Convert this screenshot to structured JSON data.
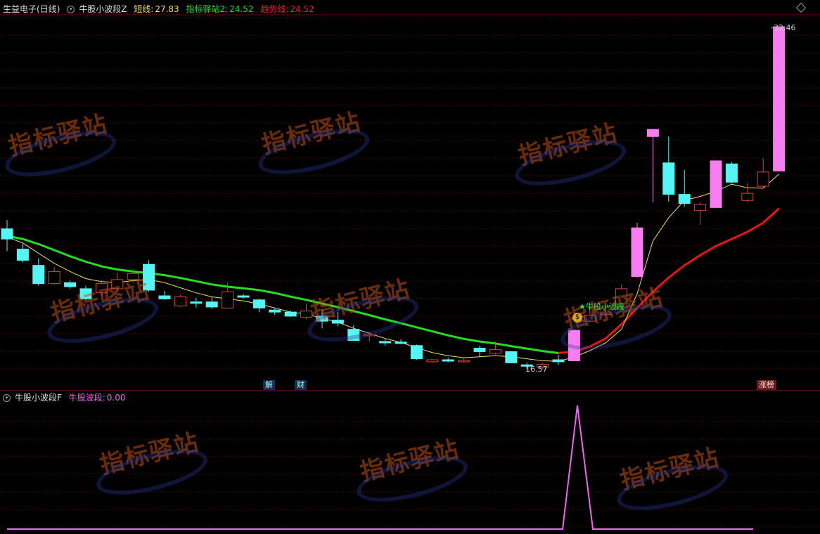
{
  "header_main": {
    "stock": "生益电子",
    "period": "(日线)",
    "indicator": "牛股小波段Z",
    "short_label": "短线:",
    "short_value": "27.83",
    "station_label": "指标驿站2:",
    "station_value": "24.52",
    "trend_label": "趋势线:",
    "trend_value": "24.52"
  },
  "header_sub": {
    "indicator": "牛股小波段F",
    "series_label": "牛股波段:",
    "series_value": "0.00"
  },
  "annotations": {
    "high_label": "32.46",
    "low_label": "16.57",
    "signal_label": "★牛股小波段",
    "event_jie": "解",
    "event_cai": "财",
    "event_zhangbang": "涨榜"
  },
  "watermark_text": "指标驿站",
  "colors": {
    "up": "#e0453a",
    "down": "#56f5f5",
    "limit_up": "#f77df0",
    "short_line": "#f0e060",
    "station_line": "#22dd22",
    "trend_line": "#ee1111",
    "sub_line": "#f065f0",
    "grid": "#5a1010",
    "background": "#000000"
  },
  "chart_data": [
    {
      "type": "candlestick",
      "title": "生益电子 (日线)",
      "y_range": [
        16.0,
        33.0
      ],
      "candles": [
        {
          "o": 22.5,
          "c": 22.0,
          "h": 22.93,
          "l": 21.4,
          "s": "down"
        },
        {
          "o": 21.5,
          "c": 20.95,
          "h": 21.75,
          "l": 20.85,
          "s": "down"
        },
        {
          "o": 20.7,
          "c": 19.8,
          "h": 21.05,
          "l": 19.7,
          "s": "down"
        },
        {
          "o": 19.8,
          "c": 20.4,
          "h": 20.62,
          "l": 19.75,
          "s": "up"
        },
        {
          "o": 19.85,
          "c": 19.65,
          "h": 19.95,
          "l": 19.55,
          "s": "down"
        },
        {
          "o": 19.55,
          "c": 19.05,
          "h": 19.7,
          "l": 18.98,
          "s": "down"
        },
        {
          "o": 19.35,
          "c": 19.8,
          "h": 19.98,
          "l": 19.2,
          "s": "up"
        },
        {
          "o": 19.55,
          "c": 20.0,
          "h": 20.35,
          "l": 19.4,
          "s": "up"
        },
        {
          "o": 20.0,
          "c": 20.3,
          "h": 20.5,
          "l": 19.85,
          "s": "up"
        },
        {
          "o": 20.75,
          "c": 19.48,
          "h": 20.95,
          "l": 19.4,
          "s": "down"
        },
        {
          "o": 19.2,
          "c": 19.05,
          "h": 19.45,
          "l": 19.0,
          "s": "down"
        },
        {
          "o": 18.7,
          "c": 19.15,
          "h": 19.25,
          "l": 18.65,
          "s": "up"
        },
        {
          "o": 18.9,
          "c": 18.85,
          "h": 19.1,
          "l": 18.62,
          "s": "down"
        },
        {
          "o": 18.9,
          "c": 18.65,
          "h": 19.12,
          "l": 18.55,
          "s": "down"
        },
        {
          "o": 18.6,
          "c": 19.4,
          "h": 19.85,
          "l": 18.6,
          "s": "up"
        },
        {
          "o": 19.2,
          "c": 19.15,
          "h": 19.3,
          "l": 19.05,
          "s": "down"
        },
        {
          "o": 19.0,
          "c": 18.6,
          "h": 19.05,
          "l": 18.4,
          "s": "down"
        },
        {
          "o": 18.5,
          "c": 18.4,
          "h": 18.62,
          "l": 18.25,
          "s": "down"
        },
        {
          "o": 18.4,
          "c": 18.2,
          "h": 18.48,
          "l": 18.15,
          "s": "down"
        },
        {
          "o": 18.15,
          "c": 18.45,
          "h": 18.82,
          "l": 18.05,
          "s": "up"
        },
        {
          "o": 18.2,
          "c": 17.95,
          "h": 18.55,
          "l": 17.6,
          "s": "down"
        },
        {
          "o": 18.0,
          "c": 17.85,
          "h": 18.4,
          "l": 17.7,
          "s": "down"
        },
        {
          "o": 17.55,
          "c": 17.0,
          "h": 17.75,
          "l": 16.98,
          "s": "down"
        },
        {
          "o": 17.28,
          "c": 17.3,
          "h": 17.45,
          "l": 16.95,
          "s": "up"
        },
        {
          "o": 16.95,
          "c": 16.9,
          "h": 17.1,
          "l": 16.75,
          "s": "down"
        },
        {
          "o": 16.92,
          "c": 16.9,
          "h": 17.05,
          "l": 16.82,
          "s": "down"
        },
        {
          "o": 16.75,
          "c": 16.1,
          "h": 16.8,
          "l": 16.05,
          "s": "down"
        },
        {
          "o": 15.95,
          "c": 16.05,
          "h": 16.1,
          "l": 15.9,
          "s": "up"
        },
        {
          "o": 16.05,
          "c": 16.0,
          "h": 16.15,
          "l": 15.92,
          "s": "down"
        },
        {
          "o": 15.98,
          "c": 16.02,
          "h": 16.12,
          "l": 15.9,
          "s": "up"
        },
        {
          "o": 16.62,
          "c": 16.45,
          "h": 16.75,
          "l": 16.2,
          "s": "down"
        },
        {
          "o": 16.37,
          "c": 16.55,
          "h": 16.95,
          "l": 16.3,
          "s": "up"
        },
        {
          "o": 16.45,
          "c": 15.9,
          "h": 16.48,
          "l": 15.88,
          "s": "down"
        },
        {
          "o": 15.8,
          "c": 15.75,
          "h": 15.9,
          "l": 15.7,
          "s": "down"
        },
        {
          "o": 15.68,
          "c": 15.82,
          "h": 15.9,
          "l": 15.6,
          "s": "up"
        },
        {
          "o": 16.05,
          "c": 15.95,
          "h": 16.3,
          "l": 15.8,
          "s": "down"
        },
        {
          "o": 16.0,
          "c": 17.5,
          "h": 17.55,
          "l": 16.0,
          "s": "limit_up"
        },
        {
          "o": 17.95,
          "c": 18.25,
          "h": 18.62,
          "l": 17.9,
          "s": "up"
        },
        {
          "o": 18.3,
          "c": 18.35,
          "h": 18.5,
          "l": 18.15,
          "s": "up"
        },
        {
          "o": 18.6,
          "c": 19.55,
          "h": 19.75,
          "l": 18.6,
          "s": "up"
        },
        {
          "o": 20.15,
          "c": 22.55,
          "h": 22.8,
          "l": 20.1,
          "s": "limit_up"
        },
        {
          "o": 27.05,
          "c": 27.4,
          "h": 27.4,
          "l": 23.8,
          "s": "limit_up"
        },
        {
          "o": 25.75,
          "c": 24.2,
          "h": 27.05,
          "l": 23.85,
          "s": "down"
        },
        {
          "o": 24.2,
          "c": 23.75,
          "h": 25.4,
          "l": 23.6,
          "s": "down"
        },
        {
          "o": 23.4,
          "c": 23.7,
          "h": 23.82,
          "l": 22.7,
          "s": "up"
        },
        {
          "o": 23.55,
          "c": 25.85,
          "h": 25.85,
          "l": 23.55,
          "s": "limit_up"
        },
        {
          "o": 25.7,
          "c": 24.8,
          "h": 25.8,
          "l": 24.75,
          "s": "down"
        },
        {
          "o": 23.9,
          "c": 24.25,
          "h": 24.75,
          "l": 23.8,
          "s": "up"
        },
        {
          "o": 24.6,
          "c": 25.3,
          "h": 25.98,
          "l": 24.48,
          "s": "up"
        },
        {
          "o": 25.35,
          "c": 32.46,
          "h": 32.46,
          "l": 25.35,
          "s": "limit_up"
        }
      ],
      "series": [
        {
          "name": "短线",
          "color": "short_line",
          "values": [
            22.1,
            21.8,
            21.3,
            20.8,
            20.4,
            20.05,
            19.9,
            19.85,
            19.95,
            20.0,
            19.85,
            19.6,
            19.35,
            19.15,
            19.05,
            18.95,
            18.8,
            18.6,
            18.4,
            18.3,
            18.1,
            17.9,
            17.6,
            17.35,
            17.1,
            16.9,
            16.65,
            16.4,
            16.25,
            16.15,
            16.2,
            16.25,
            16.2,
            16.1,
            16.0,
            15.97,
            16.18,
            16.5,
            16.88,
            17.55,
            19.3,
            21.9,
            23.05,
            23.9,
            24.1,
            24.35,
            24.7,
            24.52,
            24.5,
            25.2
          ]
        },
        {
          "name": "指标驿站2",
          "color": "station_line",
          "values": [
            22.15,
            22.0,
            21.75,
            21.45,
            21.15,
            20.88,
            20.65,
            20.5,
            20.4,
            20.32,
            20.22,
            20.08,
            19.92,
            19.76,
            19.65,
            19.57,
            19.48,
            19.34,
            19.16,
            19.0,
            18.82,
            18.64,
            18.45,
            18.25,
            18.04,
            17.85,
            17.65,
            17.45,
            17.25,
            17.08,
            16.95,
            16.85,
            16.72,
            16.6,
            16.48,
            16.38
          ]
        },
        {
          "name": "趋势线",
          "color": "trend_line",
          "values": [
            null,
            null,
            null,
            null,
            null,
            null,
            null,
            null,
            null,
            null,
            null,
            null,
            null,
            null,
            null,
            null,
            null,
            null,
            null,
            null,
            null,
            null,
            null,
            null,
            null,
            null,
            null,
            null,
            null,
            null,
            null,
            null,
            null,
            null,
            null,
            16.38,
            16.45,
            16.7,
            17.1,
            17.8,
            18.6,
            19.4,
            20.1,
            20.7,
            21.2,
            21.65,
            22.0,
            22.35,
            22.8,
            23.5
          ]
        }
      ]
    },
    {
      "type": "line",
      "title": "牛股小波段F",
      "y_range": [
        0,
        1
      ],
      "series": [
        {
          "name": "牛股波段",
          "color": "sub_line",
          "values": [
            0,
            0,
            0,
            0,
            0,
            0,
            0,
            0,
            0,
            0,
            0,
            0,
            0,
            0,
            0,
            0,
            0,
            0,
            0,
            0,
            0,
            0,
            0,
            0,
            0,
            0,
            0,
            0,
            0,
            0,
            0,
            0,
            0,
            0,
            0,
            0,
            1,
            0,
            0,
            0,
            0,
            0,
            0,
            0,
            0,
            0,
            0,
            0,
            0,
            0
          ]
        }
      ]
    }
  ]
}
